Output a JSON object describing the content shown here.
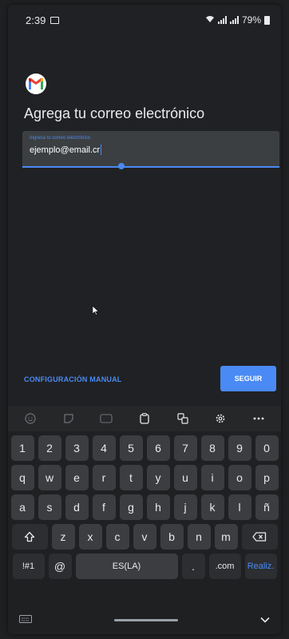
{
  "status": {
    "time": "2:39",
    "battery": "79%"
  },
  "screen": {
    "title": "Agrega tu correo electrónico",
    "email_field": {
      "label": "Ingresa tu correo electrónico",
      "value": "ejemplo@email.cr"
    },
    "manual_config_label": "CONFIGURACIÓN MANUAL",
    "next_label": "SEGUIR"
  },
  "keyboard": {
    "row_numbers": [
      "1",
      "2",
      "3",
      "4",
      "5",
      "6",
      "7",
      "8",
      "9",
      "0"
    ],
    "row_top": [
      "q",
      "w",
      "e",
      "r",
      "t",
      "y",
      "u",
      "i",
      "o",
      "p"
    ],
    "row_mid": [
      "a",
      "s",
      "d",
      "f",
      "g",
      "h",
      "j",
      "k",
      "l",
      "ñ"
    ],
    "row_bottom": [
      "z",
      "x",
      "c",
      "v",
      "b",
      "n",
      "m"
    ],
    "symbols_label": "!#1",
    "at_label": "@",
    "space_label": "ES(LA)",
    "period_label": ".",
    "dotcom_label": ".com",
    "action_label": "Realiz."
  },
  "colors": {
    "accent": "#4a8af4",
    "background": "#202124",
    "key": "#3b3d40"
  }
}
